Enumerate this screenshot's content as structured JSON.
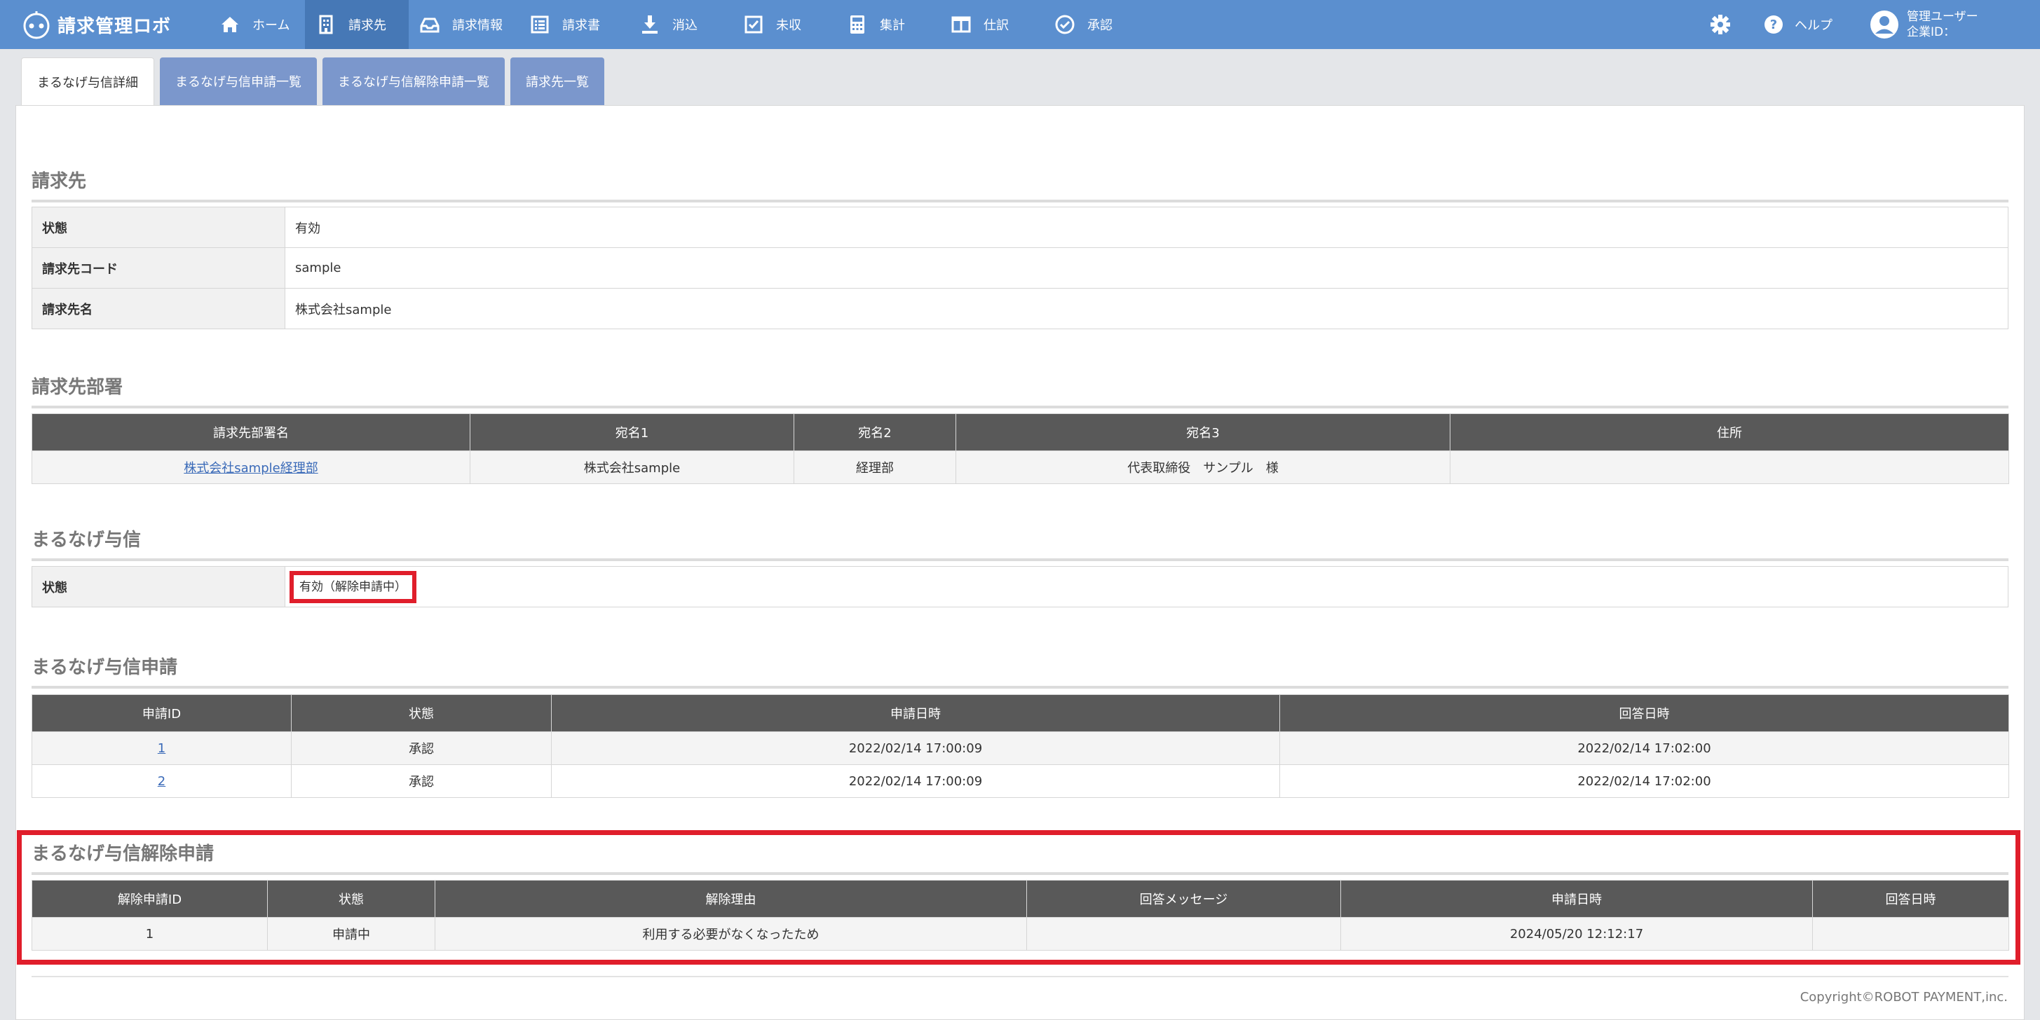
{
  "app": {
    "logo_text": "請求管理ロボ"
  },
  "nav": {
    "items": [
      {
        "icon": "home-icon",
        "label": "ホーム"
      },
      {
        "icon": "building-icon",
        "label": "請求先"
      },
      {
        "icon": "inbox-icon",
        "label": "請求情報"
      },
      {
        "icon": "list-icon",
        "label": "請求書"
      },
      {
        "icon": "download-icon",
        "label": "消込"
      },
      {
        "icon": "checkbox-icon",
        "label": "未収"
      },
      {
        "icon": "calculator-icon",
        "label": "集計"
      },
      {
        "icon": "columns-icon",
        "label": "仕訳"
      },
      {
        "icon": "check-circle-icon",
        "label": "承認"
      }
    ],
    "active_index": 1,
    "help_label": "ヘルプ",
    "user_name": "管理ユーザー",
    "company_id": "企業ID："
  },
  "tabs": [
    {
      "label": "まるなげ与信詳細",
      "active": true
    },
    {
      "label": "まるなげ与信申請一覧",
      "active": false
    },
    {
      "label": "まるなげ与信解除申請一覧",
      "active": false
    },
    {
      "label": "請求先一覧",
      "active": false
    }
  ],
  "billing": {
    "title": "請求先",
    "rows": [
      {
        "key": "状態",
        "value": "有効"
      },
      {
        "key": "請求先コード",
        "value": "sample"
      },
      {
        "key": "請求先名",
        "value": "株式会社sample"
      }
    ]
  },
  "department": {
    "title": "請求先部署",
    "headers": [
      "請求先部署名",
      "宛名1",
      "宛名2",
      "宛名3",
      "住所"
    ],
    "rows": [
      [
        "株式会社sample経理部",
        "株式会社sample",
        "経理部",
        "代表取締役　サンプル　様",
        ""
      ]
    ]
  },
  "credit": {
    "title": "まるなげ与信",
    "status_key": "状態",
    "status_value": "有効（解除申請中）"
  },
  "credit_applications": {
    "title": "まるなげ与信申請",
    "headers": [
      "申請ID",
      "状態",
      "申請日時",
      "回答日時"
    ],
    "rows": [
      [
        "1",
        "承認",
        "2022/02/14 17:00:09",
        "2022/02/14 17:02:00"
      ],
      [
        "2",
        "承認",
        "2022/02/14 17:00:09",
        "2022/02/14 17:02:00"
      ]
    ]
  },
  "cancel_applications": {
    "title": "まるなげ与信解除申請",
    "headers": [
      "解除申請ID",
      "状態",
      "解除理由",
      "回答メッセージ",
      "申請日時",
      "回答日時"
    ],
    "rows": [
      [
        "1",
        "申請中",
        "利用する必要がなくなったため",
        "",
        "2024/05/20 12:12:17",
        ""
      ]
    ]
  },
  "footer": {
    "copyright": "Copyright©ROBOT PAYMENT,inc."
  },
  "colors": {
    "nav_bg": "#5b8fcf",
    "nav_active": "#4678b6",
    "tab_bg": "#7b97cc",
    "highlight": "#e01e2b",
    "table_header": "#595959"
  }
}
